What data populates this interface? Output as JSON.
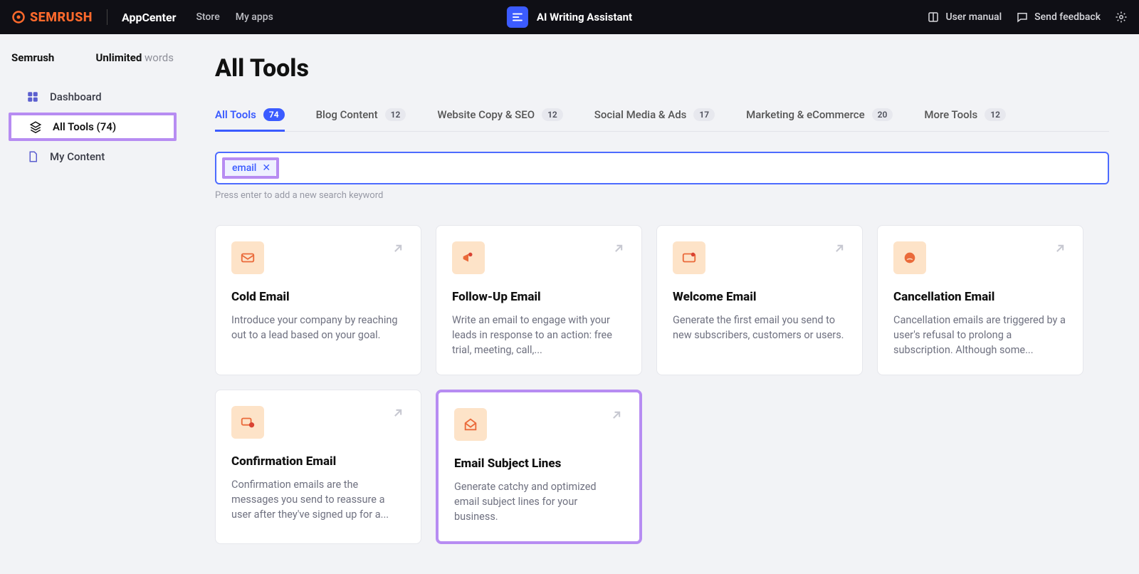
{
  "topbar": {
    "brand": "SEMRUSH",
    "appcenter": "AppCenter",
    "nav": {
      "store": "Store",
      "myapps": "My apps"
    },
    "app_title": "AI Writing Assistant",
    "right": {
      "manual": "User manual",
      "feedback": "Send feedback"
    }
  },
  "sidebar": {
    "plan_name": "Semrush",
    "plan_unlimited": "Unlimited",
    "plan_words": " words",
    "items": {
      "dashboard": "Dashboard",
      "all_tools": "All Tools (74)",
      "my_content": "My Content"
    }
  },
  "page": {
    "title": "All Tools"
  },
  "tabs": [
    {
      "label": "All Tools",
      "count": "74"
    },
    {
      "label": "Blog Content",
      "count": "12"
    },
    {
      "label": "Website Copy & SEO",
      "count": "12"
    },
    {
      "label": "Social Media & Ads",
      "count": "17"
    },
    {
      "label": "Marketing & eCommerce",
      "count": "20"
    },
    {
      "label": "More Tools",
      "count": "12"
    }
  ],
  "search": {
    "chip": "email",
    "hint": "Press enter to add a new search keyword"
  },
  "cards": [
    {
      "title": "Cold Email",
      "desc": "Introduce your company by reaching out to a lead based on your goal."
    },
    {
      "title": "Follow-Up Email",
      "desc": "Write an email to engage with your leads in response to an action: free trial, meeting, call,..."
    },
    {
      "title": "Welcome Email",
      "desc": "Generate the first email you send to new subscribers, customers or users."
    },
    {
      "title": "Cancellation Email",
      "desc": "Cancellation emails are triggered by a user's refusal to prolong a subscription. Although some..."
    },
    {
      "title": "Confirmation Email",
      "desc": "Confirmation emails are the messages you send to reassure a user after they've signed up for a..."
    },
    {
      "title": "Email Subject Lines",
      "desc": "Generate catchy and optimized email subject lines for your business."
    }
  ]
}
